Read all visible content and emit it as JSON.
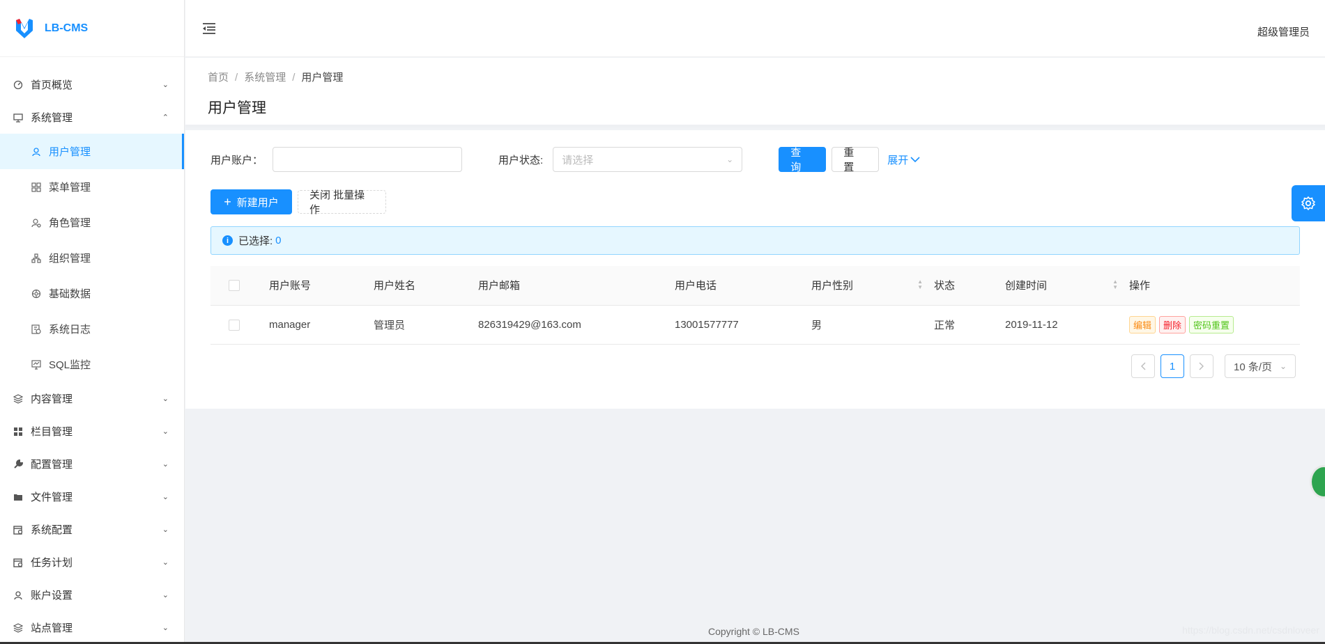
{
  "app": {
    "logo_text": "LB-CMS"
  },
  "header": {
    "user_name": "超级管理员"
  },
  "sidebar": {
    "items": [
      {
        "label": "首页概览",
        "icon": "dashboard-icon",
        "expanded": false
      },
      {
        "label": "系统管理",
        "icon": "monitor-icon",
        "expanded": true
      },
      {
        "label": "内容管理",
        "icon": "layers-icon",
        "expanded": false
      },
      {
        "label": "栏目管理",
        "icon": "grid-icon",
        "expanded": false
      },
      {
        "label": "配置管理",
        "icon": "wrench-icon",
        "expanded": false
      },
      {
        "label": "文件管理",
        "icon": "folder-icon",
        "expanded": false
      },
      {
        "label": "系统配置",
        "icon": "calendar-icon",
        "expanded": false
      },
      {
        "label": "任务计划",
        "icon": "schedule-icon",
        "expanded": false
      },
      {
        "label": "账户设置",
        "icon": "user-icon",
        "expanded": false
      },
      {
        "label": "站点管理",
        "icon": "sites-icon",
        "expanded": false
      }
    ],
    "sub_items": [
      {
        "label": "用户管理",
        "icon": "user-icon",
        "active": true
      },
      {
        "label": "菜单管理",
        "icon": "apps-icon",
        "active": false
      },
      {
        "label": "角色管理",
        "icon": "role-icon",
        "active": false
      },
      {
        "label": "组织管理",
        "icon": "org-icon",
        "active": false
      },
      {
        "label": "基础数据",
        "icon": "database-icon",
        "active": false
      },
      {
        "label": "系统日志",
        "icon": "log-icon",
        "active": false
      },
      {
        "label": "SQL监控",
        "icon": "monitor-icon",
        "active": false
      }
    ]
  },
  "breadcrumb": [
    "首页",
    "系统管理",
    "用户管理"
  ],
  "page_title": "用户管理",
  "filters": {
    "account_label": "用户账户：",
    "account_value": "",
    "status_label": "用户状态:",
    "status_placeholder": "请选择",
    "query_label": "查 询",
    "reset_label": "重 置",
    "expand_label": "展开"
  },
  "toolbar": {
    "new_user_label": "新建用户",
    "batch_label": "关闭 批量操作"
  },
  "selection": {
    "label": "已选择:",
    "count": "0"
  },
  "table": {
    "columns": [
      "用户账号",
      "用户姓名",
      "用户邮箱",
      "用户电话",
      "用户性别",
      "状态",
      "创建时间",
      "操作"
    ],
    "rows": [
      {
        "account": "manager",
        "name": "管理员",
        "email": "826319429@163.com",
        "phone": "13001577777",
        "gender": "男",
        "status": "正常",
        "created": "2019-11-12",
        "actions": [
          "编辑",
          "删除",
          "密码重置"
        ]
      }
    ]
  },
  "pagination": {
    "current": "1",
    "page_size": "10 条/页"
  },
  "footer": {
    "copyright": "Copyright © LB-CMS"
  },
  "watermark": "https://blog.csdn.net/csdnloveer",
  "colors": {
    "primary": "#1890ff",
    "active_bg": "#e6f7ff"
  }
}
